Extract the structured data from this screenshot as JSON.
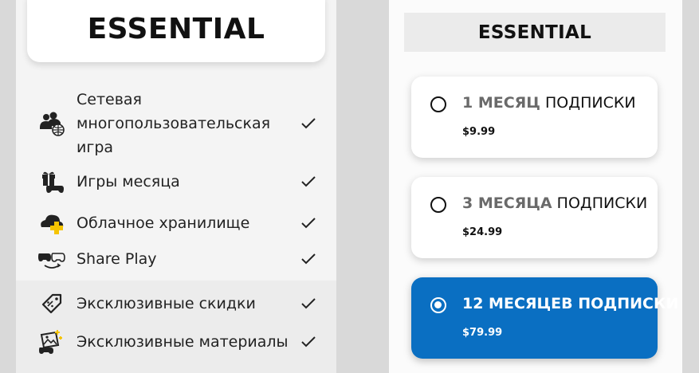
{
  "left_panel": {
    "title": "ESSENTIAL",
    "features": [
      {
        "icon": "multiplayer-icon",
        "lines": [
          "Сетевая",
          "многопользовательская",
          "игра"
        ]
      },
      {
        "icon": "gift-controller-icon",
        "label": "Игры месяца"
      },
      {
        "icon": "cloud-plus-icon",
        "label": "Облачное хранилище"
      },
      {
        "icon": "share-play-icon",
        "label": "Share Play"
      },
      {
        "icon": "discount-tag-icon",
        "label": "Эксклюзивные скидки"
      },
      {
        "icon": "exclusive-content-icon",
        "label": "Эксклюзивные материалы"
      }
    ]
  },
  "right_panel": {
    "title": "ESSENTIAL",
    "plans": [
      {
        "duration": "1 МЕСЯЦ",
        "suffix": " ПОДПИСКИ",
        "price": "$9.99",
        "selected": false
      },
      {
        "duration": "3 МЕСЯЦА",
        "suffix": " ПОДПИСКИ",
        "price": "$24.99",
        "selected": false
      },
      {
        "duration": "12 МЕСЯЦЕВ",
        "suffix": " ПОДПИСКИ",
        "price": "$79.99",
        "selected": true
      }
    ]
  },
  "colors": {
    "selected_plan": "#0a6fc2",
    "plus_accent": "#f5c400",
    "background": "#d9d9d9"
  }
}
